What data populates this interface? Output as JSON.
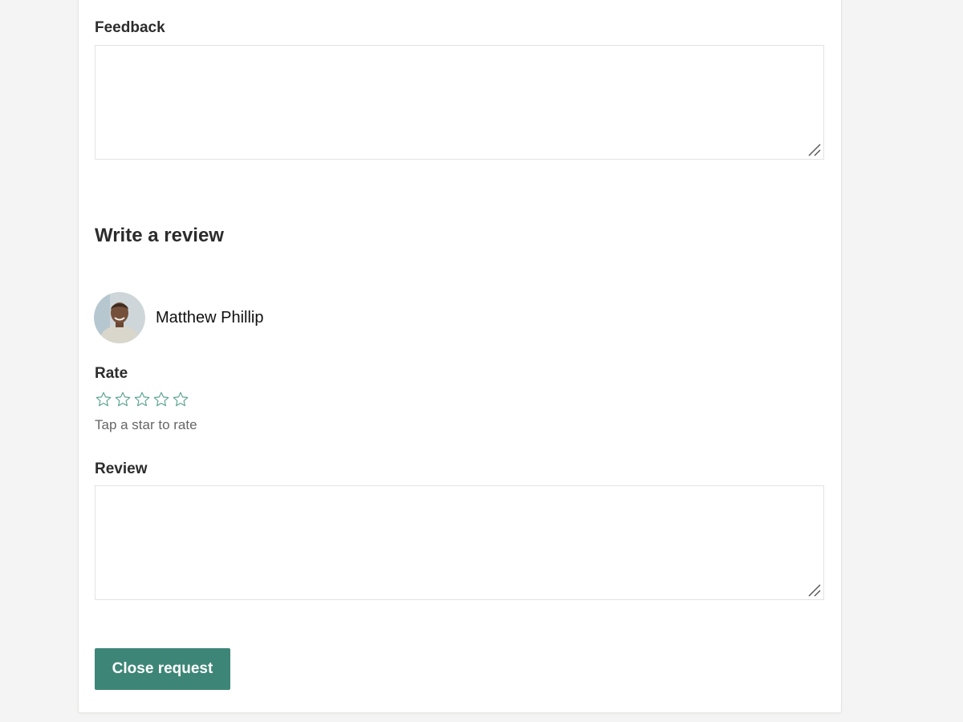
{
  "feedback": {
    "label": "Feedback",
    "value": "",
    "placeholder": ""
  },
  "review_section": {
    "title": "Write a review",
    "user": {
      "name": "Matthew Phillip",
      "avatar_icon": "user-avatar-photo"
    },
    "rate": {
      "label": "Rate",
      "max_stars": 5,
      "value": 0,
      "hint": "Tap a star to rate"
    },
    "review": {
      "label": "Review",
      "value": "",
      "placeholder": ""
    }
  },
  "actions": {
    "close_label": "Close request"
  },
  "colors": {
    "accent": "#3d8677",
    "star_outline": "#5fa596",
    "page_background": "#f3f4f3",
    "card_background": "#ffffff"
  }
}
